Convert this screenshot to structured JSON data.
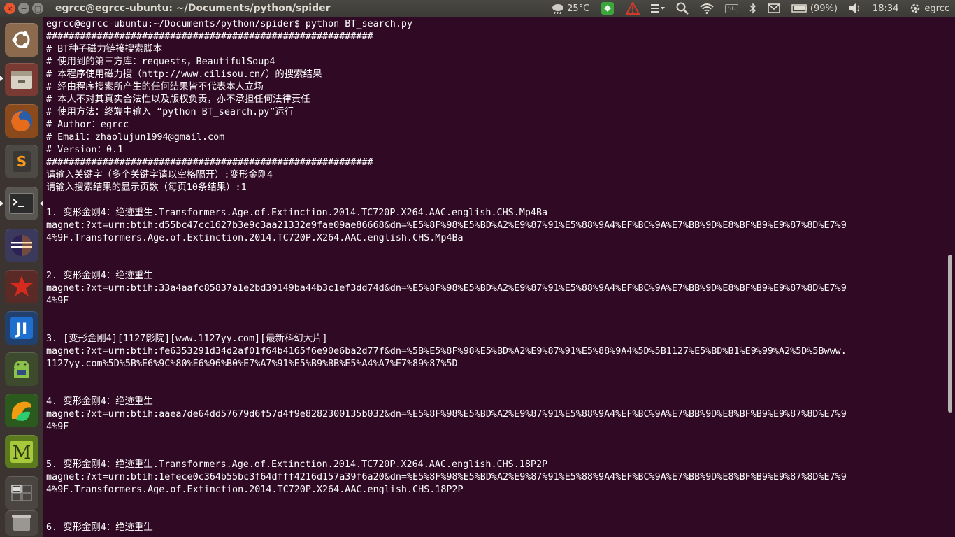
{
  "window": {
    "title": "egrcc@egrcc-ubuntu: ~/Documents/python/spider"
  },
  "panel": {
    "weather": "25°C",
    "battery": "(99%)",
    "time": "18:34",
    "user": "egrcc",
    "keyboard": "Su"
  },
  "launcher": {
    "items": [
      "ubuntu-dash",
      "files",
      "firefox",
      "sublime-text",
      "terminal",
      "eclipse",
      "mathematica",
      "intellij-idea",
      "android-sdk",
      "pycharm",
      "mendeley",
      "workspace-switcher",
      "trash"
    ]
  },
  "terminal": {
    "lines": [
      "egrcc@egrcc-ubuntu:~/Documents/python/spider$ python BT_search.py",
      "##########################################################",
      "# BT种子磁力链接搜索脚本",
      "# 使用到的第三方库：requests，BeautifulSoup4",
      "# 本程序使用磁力搜（http://www.cilisou.cn/）的搜索结果",
      "# 经由程序搜索所产生的任何结果皆不代表本人立场",
      "# 本人不对其真实合法性以及版权负责，亦不承担任何法律责任",
      "# 使用方法：终端中输入 “python BT_search.py”运行",
      "# Author：egrcc",
      "# Email：zhaolujun1994@gmail.com",
      "# Version：0.1",
      "##########################################################",
      "请输入关键字（多个关键字请以空格隔开）:变形金刚4",
      "请输入搜索结果的显示页数（每页10条结果）:1",
      "",
      "1. 变形金刚4：绝迹重生.Transformers.Age.of.Extinction.2014.TC720P.X264.AAC.english.CHS.Mp4Ba",
      "magnet:?xt=urn:btih:d55bc47cc1627b3e9c3aa21332e9fae09ae86668&dn=%E5%8F%98%E5%BD%A2%E9%87%91%E5%88%9A4%EF%BC%9A%E7%BB%9D%E8%BF%B9%E9%87%8D%E7%9",
      "4%9F.Transformers.Age.of.Extinction.2014.TC720P.X264.AAC.english.CHS.Mp4Ba",
      "",
      "",
      "2. 变形金刚4：绝迹重生",
      "magnet:?xt=urn:btih:33a4aafc85837a1e2bd39149ba44b3c1ef3dd74d&dn=%E5%8F%98%E5%BD%A2%E9%87%91%E5%88%9A4%EF%BC%9A%E7%BB%9D%E8%BF%B9%E9%87%8D%E7%9",
      "4%9F",
      "",
      "",
      "3. [变形金刚4][1127影院][www.1127yy.com][最新科幻大片]",
      "magnet:?xt=urn:btih:fe6353291d34d2af01f64b4165f6e90e6ba2d77f&dn=%5B%E5%8F%98%E5%BD%A2%E9%87%91%E5%88%9A4%5D%5B1127%E5%BD%B1%E9%99%A2%5D%5Bwww.",
      "1127yy.com%5D%5B%E6%9C%80%E6%96%B0%E7%A7%91%E5%B9%BB%E5%A4%A7%E7%89%87%5D",
      "",
      "",
      "4. 变形金刚4：绝迹重生",
      "magnet:?xt=urn:btih:aaea7de64dd57679d6f57d4f9e8282300135b032&dn=%E5%8F%98%E5%BD%A2%E9%87%91%E5%88%9A4%EF%BC%9A%E7%BB%9D%E8%BF%B9%E9%87%8D%E7%9",
      "4%9F",
      "",
      "",
      "5. 变形金刚4：绝迹重生.Transformers.Age.of.Extinction.2014.TC720P.X264.AAC.english.CHS.18P2P",
      "magnet:?xt=urn:btih:1efece0c364b55bc3f64dfff4216d157a39f6a20&dn=%E5%8F%98%E5%BD%A2%E9%87%91%E5%88%9A4%EF%BC%9A%E7%BB%9D%E8%BF%B9%E9%87%8D%E7%9",
      "4%9F.Transformers.Age.of.Extinction.2014.TC720P.X264.AAC.english.CHS.18P2P",
      "",
      "",
      "6. 变形金刚4：绝迹重生"
    ]
  },
  "colors": {
    "terminal_bg": "#300a24",
    "terminal_fg": "#ffffff",
    "panel_bg": "#3c3b37",
    "close_button": "#e8552f"
  }
}
